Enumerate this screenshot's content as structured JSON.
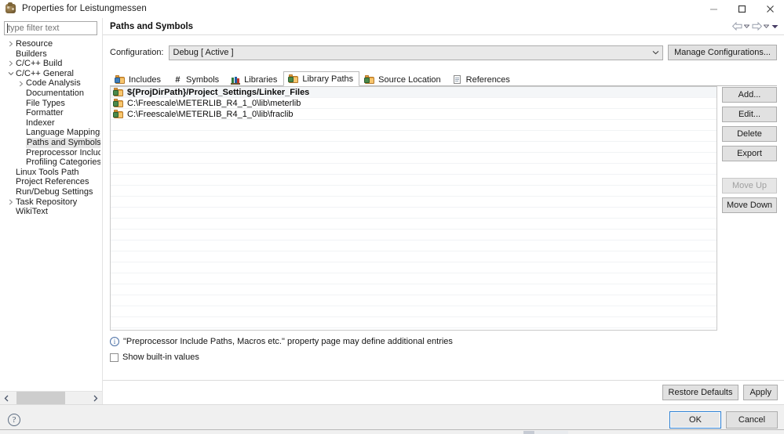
{
  "window": {
    "title": "Properties for Leistungmessen",
    "icon": "eclipse-app-icon",
    "minimize_label": "Minimize",
    "maximize_label": "Maximize",
    "close_label": "Close"
  },
  "filter": {
    "value": "",
    "placeholder": "type filter text"
  },
  "tree": {
    "items": [
      {
        "label": "Resource",
        "indent": 0,
        "twisty": "collapsed",
        "selected": false
      },
      {
        "label": "Builders",
        "indent": 0,
        "twisty": "none",
        "selected": false
      },
      {
        "label": "C/C++ Build",
        "indent": 0,
        "twisty": "collapsed",
        "selected": false
      },
      {
        "label": "C/C++ General",
        "indent": 0,
        "twisty": "expanded",
        "selected": false
      },
      {
        "label": "Code Analysis",
        "indent": 1,
        "twisty": "collapsed",
        "selected": false
      },
      {
        "label": "Documentation",
        "indent": 1,
        "twisty": "none",
        "selected": false
      },
      {
        "label": "File Types",
        "indent": 1,
        "twisty": "none",
        "selected": false
      },
      {
        "label": "Formatter",
        "indent": 1,
        "twisty": "none",
        "selected": false
      },
      {
        "label": "Indexer",
        "indent": 1,
        "twisty": "none",
        "selected": false
      },
      {
        "label": "Language Mappings",
        "indent": 1,
        "twisty": "none",
        "selected": false
      },
      {
        "label": "Paths and Symbols",
        "indent": 1,
        "twisty": "none",
        "selected": true
      },
      {
        "label": "Preprocessor Include Pa",
        "indent": 1,
        "twisty": "none",
        "selected": false
      },
      {
        "label": "Profiling Categories",
        "indent": 1,
        "twisty": "none",
        "selected": false
      },
      {
        "label": "Linux Tools Path",
        "indent": 0,
        "twisty": "none",
        "selected": false
      },
      {
        "label": "Project References",
        "indent": 0,
        "twisty": "none",
        "selected": false
      },
      {
        "label": "Run/Debug Settings",
        "indent": 0,
        "twisty": "none",
        "selected": false
      },
      {
        "label": "Task Repository",
        "indent": 0,
        "twisty": "collapsed",
        "selected": false
      },
      {
        "label": "WikiText",
        "indent": 0,
        "twisty": "none",
        "selected": false
      }
    ]
  },
  "page": {
    "title": "Paths and Symbols",
    "nav": {
      "back_icon": "back-arrow-icon",
      "back_menu_icon": "chevron-down-icon",
      "forward_icon": "forward-arrow-icon",
      "forward_menu_icon": "chevron-down-icon",
      "menu_icon": "filled-chevron-down-icon"
    }
  },
  "configuration": {
    "label": "Configuration:",
    "value": "Debug  [ Active ]",
    "manage_label": "Manage Configurations..."
  },
  "tabs": [
    {
      "label": "Includes",
      "icon": "includes-folder-icon",
      "active": false
    },
    {
      "label": "Symbols",
      "icon": "hash-symbol-icon",
      "active": false
    },
    {
      "label": "Libraries",
      "icon": "books-icon",
      "active": false
    },
    {
      "label": "Library Paths",
      "icon": "library-folder-icon",
      "active": true
    },
    {
      "label": "Source Location",
      "icon": "source-folder-icon",
      "active": false
    },
    {
      "label": "References",
      "icon": "document-icon",
      "active": false
    }
  ],
  "library_paths": {
    "rows": [
      {
        "text": "${ProjDirPath}/Project_Settings/Linker_Files",
        "icon": "library-folder-icon",
        "bold": true
      },
      {
        "text": "C:\\Freescale\\METERLIB_R4_1_0\\lib\\meterlib",
        "icon": "library-folder-icon",
        "bold": false
      },
      {
        "text": "C:\\Freescale\\METERLIB_R4_1_0\\lib\\fraclib",
        "icon": "library-folder-icon",
        "bold": false
      }
    ],
    "empty_row_count": 19
  },
  "side_buttons": [
    {
      "label": "Add...",
      "enabled": true,
      "group": 1
    },
    {
      "label": "Edit...",
      "enabled": true,
      "group": 1
    },
    {
      "label": "Delete",
      "enabled": true,
      "group": 1
    },
    {
      "label": "Export",
      "enabled": true,
      "group": 1
    },
    {
      "label": "Move Up",
      "enabled": false,
      "group": 2
    },
    {
      "label": "Move Down",
      "enabled": true,
      "group": 2
    }
  ],
  "note": {
    "icon": "info-icon",
    "text": "\"Preprocessor Include Paths, Macros etc.\" property page may define additional entries"
  },
  "show_builtin": {
    "label": "Show built-in values",
    "checked": false
  },
  "apply_bar": {
    "restore_defaults_label": "Restore Defaults",
    "apply_label": "Apply"
  },
  "footer": {
    "help_icon": "help-question-icon",
    "ok_label": "OK",
    "cancel_label": "Cancel"
  },
  "colors": {
    "accent": "#2a7fd4",
    "selection": "#e6e6e6",
    "folder": "#e8a33d",
    "border": "#adadad"
  }
}
